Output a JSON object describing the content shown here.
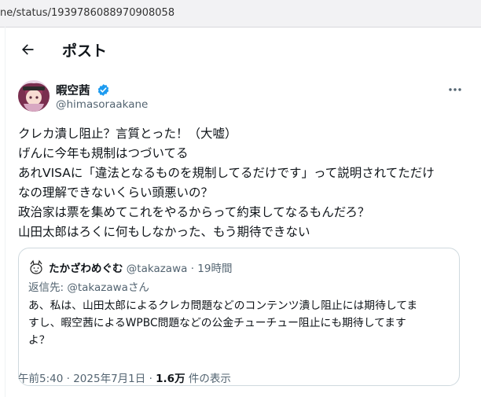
{
  "browser": {
    "url_text": "ne/status/1939786088970908058"
  },
  "header": {
    "title": "ポスト"
  },
  "author": {
    "display_name": "暇空茜",
    "handle": "@himasoraakane"
  },
  "tweet": {
    "lines": [
      "クレカ潰し阻止？言質とった！（大嘘）",
      "げんに今年も規制はつづいてる",
      "あれVISAに「違法となるものを規制してるだけです」って説明されてただけ",
      "なの理解できないくらい頭悪いの？",
      "政治家は票を集めてこれをやるからって約束してなるもんだろ？",
      "山田太郎はろくに何もしなかった、もう期待できない"
    ]
  },
  "quote": {
    "display_name": "たかざわめぐむ",
    "handle": "@takazawa",
    "separator": "·",
    "time": "19時間",
    "reply_prefix": "返信先: ",
    "reply_mention": "@takazawa",
    "reply_suffix": "さん",
    "lines": [
      "あ、私は、山田太郎によるクレカ問題などのコンテンツ潰し阻止には期待してま",
      "すし、暇空茜によるWPBC問題などの公金チューチュー阻止にも期待してます",
      "よ？"
    ]
  },
  "meta": {
    "time": "午前5:40",
    "separator1": "·",
    "date": "2025年7月1日",
    "separator2": "·",
    "views_count": "1.6万",
    "views_label": "件の表示"
  },
  "colors": {
    "verified": "#1d9bf0",
    "text": "#0f1419",
    "secondary": "#536471",
    "border": "#cfd9de"
  }
}
